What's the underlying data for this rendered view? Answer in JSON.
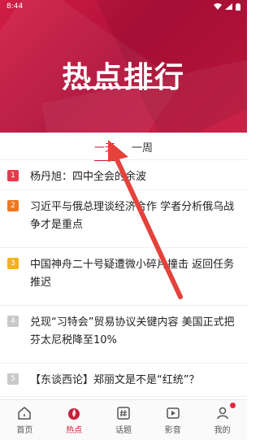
{
  "status_bar": {
    "time": "8:44"
  },
  "hero": {
    "title": "热点排行"
  },
  "tabs": [
    {
      "label": "一天",
      "active": true
    },
    {
      "label": "一周",
      "active": false
    }
  ],
  "news": [
    {
      "rank": "1",
      "title": "杨丹旭：四中全会的余波",
      "rank_color": "#e83a4c"
    },
    {
      "rank": "2",
      "title": "习近平与俄总理谈经济合作 学者分析俄乌战争才是重点",
      "rank_color": "#f0771f"
    },
    {
      "rank": "3",
      "title": "中国神舟二十号疑遭微小碎片撞击 返回任务推迟",
      "rank_color": "#f3b21c"
    },
    {
      "rank": "4",
      "title": "兑现“习特会”贸易协议关键内容 美国正式把芬太尼税降至10%",
      "rank_color": "#c9c9c9"
    },
    {
      "rank": "5",
      "title": "【东谈西论】郑丽文是不是“红统”？",
      "rank_color": "#c9c9c9"
    }
  ],
  "bottom_nav": [
    {
      "label": "首页",
      "icon": "home-icon",
      "active": false
    },
    {
      "label": "热点",
      "icon": "flame-icon",
      "active": true
    },
    {
      "label": "话题",
      "icon": "hashtag-icon",
      "active": false
    },
    {
      "label": "影音",
      "icon": "video-icon",
      "active": false
    },
    {
      "label": "我的",
      "icon": "profile-icon",
      "active": false,
      "badge_dot": true
    }
  ],
  "colors": {
    "accent": "#c81e3a",
    "hero_background": "#c8173f"
  }
}
